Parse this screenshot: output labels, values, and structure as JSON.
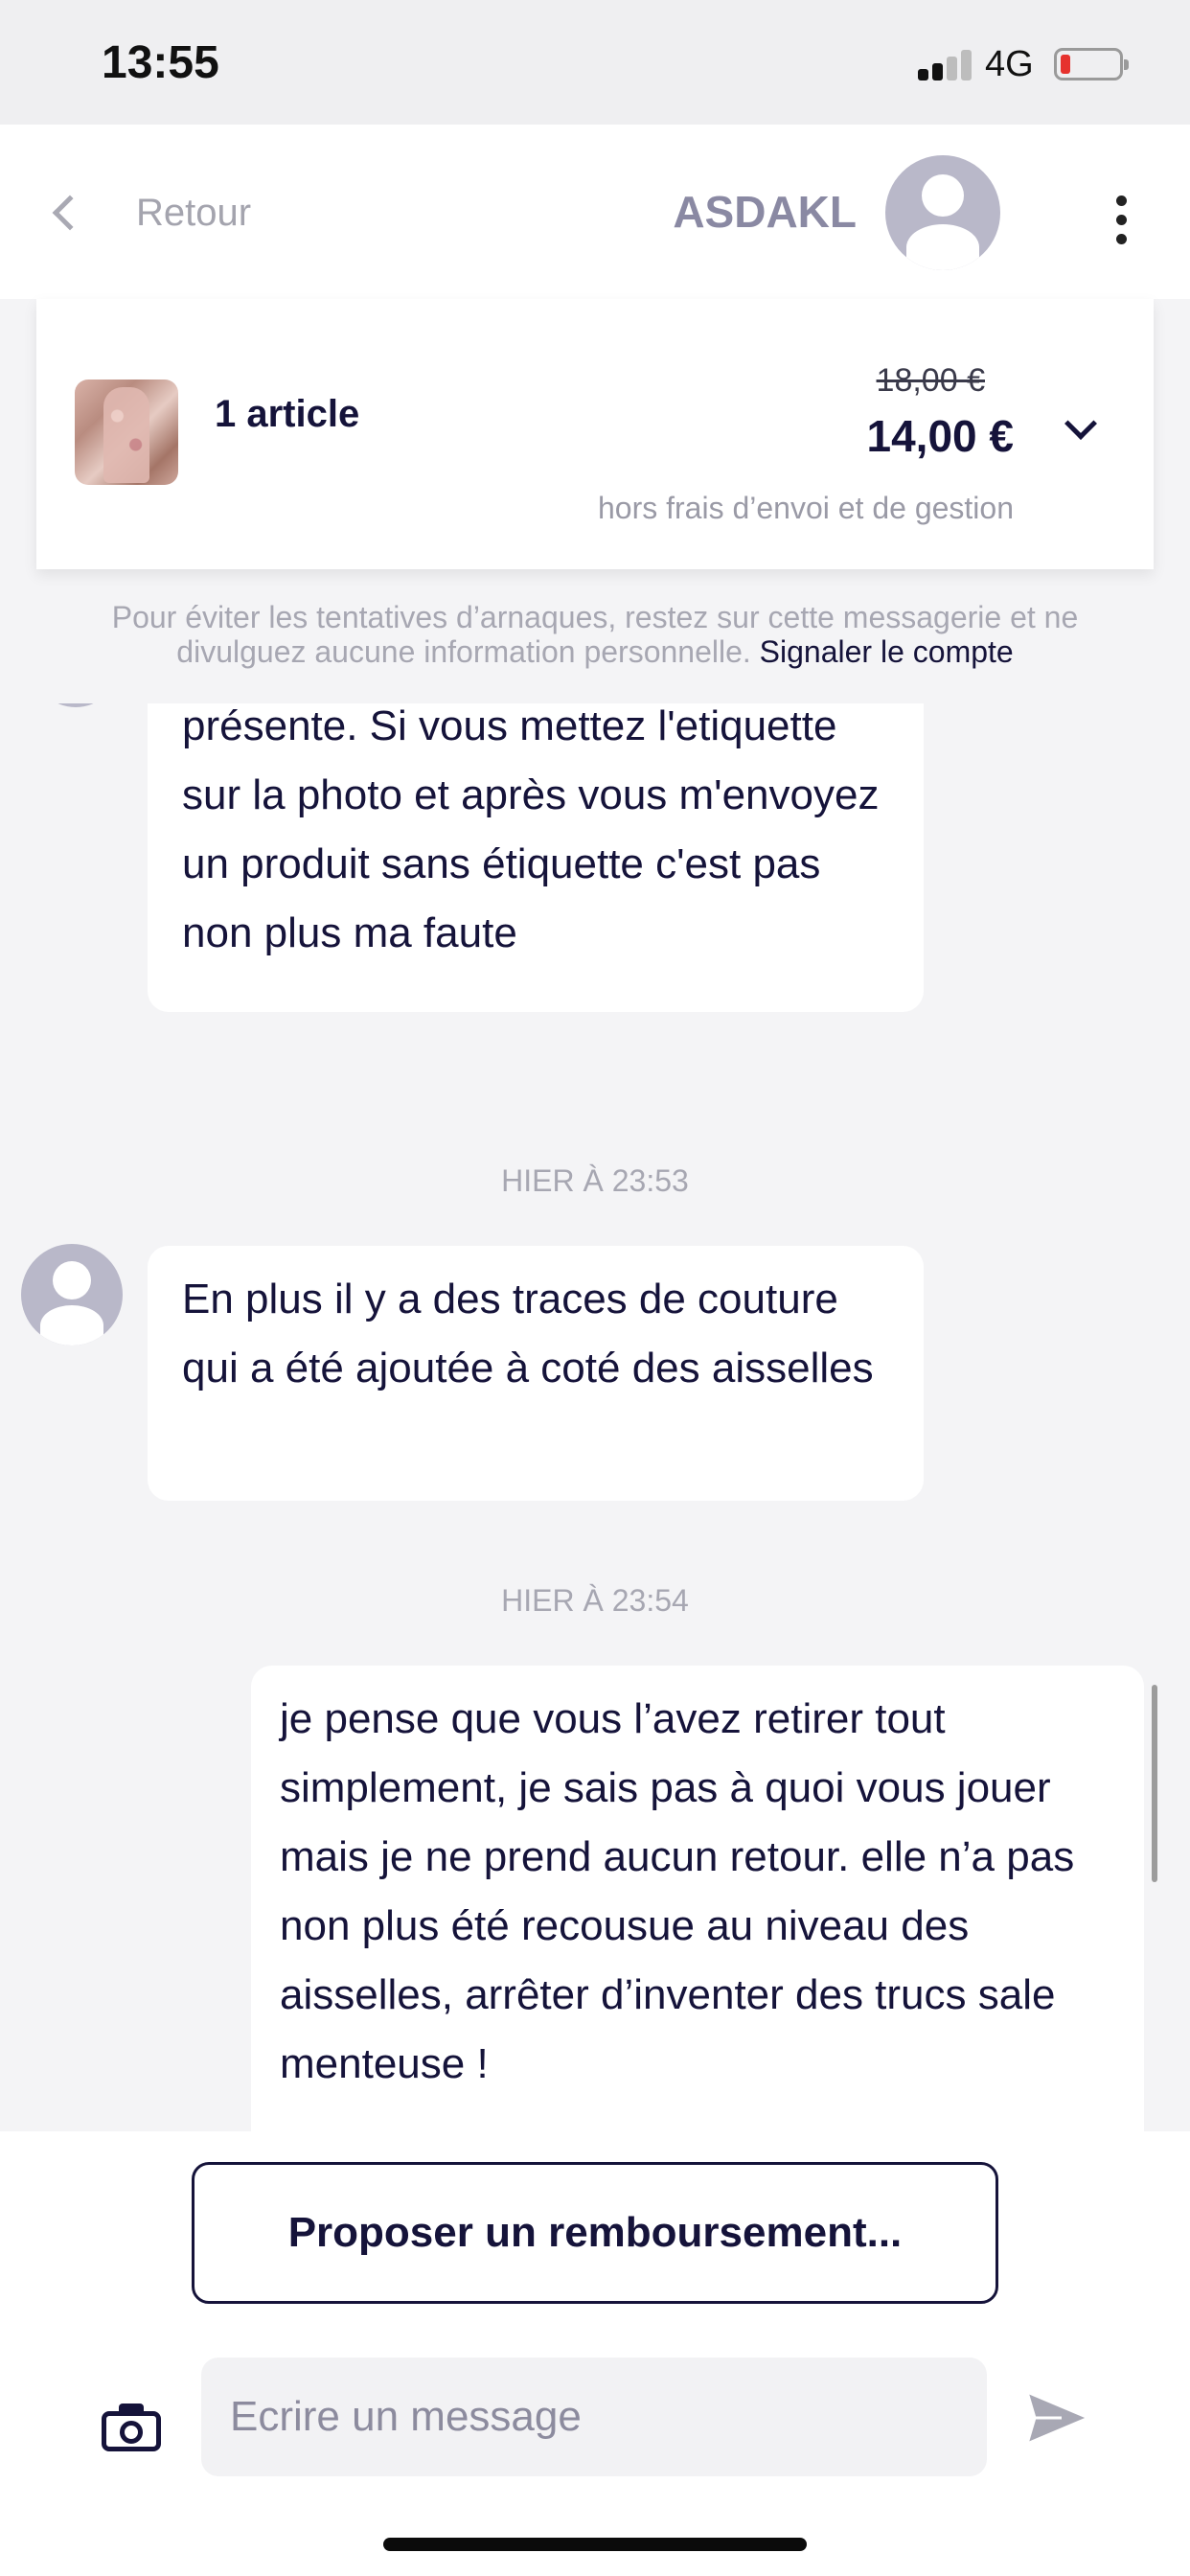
{
  "status_bar": {
    "time": "13:55",
    "network": "4G"
  },
  "header": {
    "back_label": "Retour",
    "contact_name": "ASDAKL"
  },
  "order": {
    "article_count": "1 article",
    "old_price": "18,00 €",
    "new_price": "14,00 €",
    "shipping_note": "hors frais d’envoi et de gestion"
  },
  "warning": {
    "text": "Pour éviter les tentatives d’arnaques, restez sur cette messagerie et ne divulguez aucune information personnelle.",
    "report_link": "Signaler le compte"
  },
  "messages": [
    {
      "sender": "other",
      "text": "présente. Si vous mettez l'etiquette sur la photo et après vous m'envoyez un produit sans étiquette c'est pas non plus ma faute"
    },
    {
      "timestamp": "HIER À 23:53"
    },
    {
      "sender": "other",
      "text": "En plus il y a des traces de couture qui a été ajoutée à coté des aisselles"
    },
    {
      "timestamp": "HIER À 23:54"
    },
    {
      "sender": "me",
      "text": "je pense que vous l’avez retirer tout simplement, je sais pas à quoi vous jouer mais je ne prend aucun retour. elle n’a pas non plus été recousue au niveau des aisselles, arrêter d’inventer des trucs sale menteuse !"
    }
  ],
  "actions": {
    "refund_button": "Proposer un remboursement...",
    "message_placeholder": "Ecrire un message"
  },
  "icons": {
    "back": "chevron-left-icon",
    "more": "more-vertical-icon",
    "expand": "chevron-down-icon",
    "camera": "camera-icon",
    "send": "send-icon"
  },
  "colors": {
    "primary": "#15133a",
    "muted_text": "#a7a7b2",
    "avatar_bg": "#b9b8c9",
    "battery_low": "#e6322e"
  }
}
